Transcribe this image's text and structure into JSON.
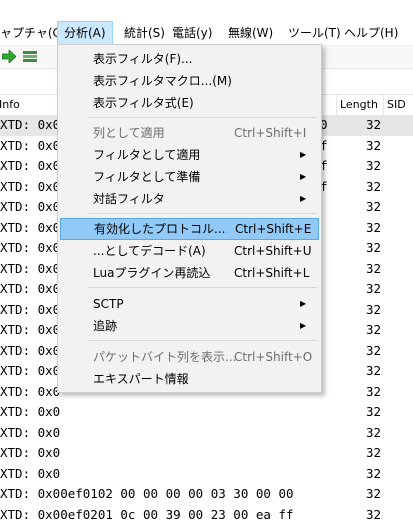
{
  "menubar": {
    "items": [
      {
        "label": "ャプチャ(C)"
      },
      {
        "label": "分析(A)"
      },
      {
        "label": "統計(S)"
      },
      {
        "label": "電話(y)"
      },
      {
        "label": "無線(W)"
      },
      {
        "label": "ツール(T)"
      },
      {
        "label": "ヘルプ(H)"
      }
    ]
  },
  "toolbar": {
    "icons": [
      "forward-arrow-icon",
      "filter-config-icon"
    ]
  },
  "packet_list": {
    "columns": {
      "info": "Info",
      "length": "Length",
      "sid": "SID"
    },
    "rows": [
      {
        "info": "XTD: 0x0",
        "tail": "0",
        "length": "32"
      },
      {
        "info": "XTD: 0x0",
        "tail": "f",
        "length": "32"
      },
      {
        "info": "XTD: 0x0",
        "tail": "f",
        "length": "32"
      },
      {
        "info": "XTD: 0x0",
        "tail": "f",
        "length": "32"
      },
      {
        "info": "XTD: 0x0",
        "tail": "",
        "length": "32"
      },
      {
        "info": "XTD: 0x0",
        "tail": "",
        "length": "32"
      },
      {
        "info": "XTD: 0x0",
        "tail": "",
        "length": "32"
      },
      {
        "info": "XTD: 0x0",
        "tail": "",
        "length": "32"
      },
      {
        "info": "XTD: 0x0",
        "tail": "",
        "length": "32"
      },
      {
        "info": "XTD: 0x0",
        "tail": "",
        "length": "32"
      },
      {
        "info": "XTD: 0x0",
        "tail": "",
        "length": "32"
      },
      {
        "info": "XTD: 0x0",
        "tail": "",
        "length": "32"
      },
      {
        "info": "XTD: 0x0",
        "tail": "",
        "length": "32"
      },
      {
        "info": "XTD: 0x0",
        "tail": "",
        "length": "32"
      },
      {
        "info": "XTD: 0x0",
        "tail": "",
        "length": "32"
      },
      {
        "info": "XTD: 0x0",
        "tail": "",
        "length": "32"
      },
      {
        "info": "XTD: 0x0",
        "tail": "",
        "length": "32"
      },
      {
        "info": "XTD: 0x0",
        "tail": "",
        "length": "32"
      },
      {
        "info": "XTD: 0x00ef0102   00 00 00 00 03 30 00 00",
        "tail": "",
        "length": "32"
      },
      {
        "info": "XTD: 0x00ef0201   0c 00 39 00 23 00 ea ff",
        "tail": "",
        "length": "32"
      }
    ]
  },
  "analyze_menu": {
    "items": [
      {
        "label": "表示フィルタ(F)...",
        "shortcut": "",
        "submenu": false,
        "disabled": false
      },
      {
        "label": "表示フィルタマクロ...(M)",
        "shortcut": "",
        "submenu": false,
        "disabled": false
      },
      {
        "label": "表示フィルタ式(E)",
        "shortcut": "",
        "submenu": false,
        "disabled": false
      },
      {
        "label": "列として適用",
        "shortcut": "Ctrl+Shift+I",
        "submenu": false,
        "disabled": true
      },
      {
        "label": "フィルタとして適用",
        "shortcut": "",
        "submenu": true,
        "disabled": false
      },
      {
        "label": "フィルタとして準備",
        "shortcut": "",
        "submenu": true,
        "disabled": false
      },
      {
        "label": "対話フィルタ",
        "shortcut": "",
        "submenu": true,
        "disabled": false
      },
      {
        "label": "有効化したプロトコル...",
        "shortcut": "Ctrl+Shift+E",
        "submenu": false,
        "disabled": false,
        "highlighted": true
      },
      {
        "label": "...としてデコード(A)",
        "shortcut": "Ctrl+Shift+U",
        "submenu": false,
        "disabled": false
      },
      {
        "label": "Luaプラグイン再読込",
        "shortcut": "Ctrl+Shift+L",
        "submenu": false,
        "disabled": false
      },
      {
        "label": "SCTP",
        "shortcut": "",
        "submenu": true,
        "disabled": false
      },
      {
        "label": "追跡",
        "shortcut": "",
        "submenu": true,
        "disabled": false
      },
      {
        "label": "パケットバイト列を表示...",
        "shortcut": "Ctrl+Shift+O",
        "submenu": false,
        "disabled": true
      },
      {
        "label": "エキスパート情報",
        "shortcut": "",
        "submenu": false,
        "disabled": false
      }
    ],
    "submenu_arrow": "▶"
  },
  "colors": {
    "highlight": "#91c9f7",
    "menu_bg": "#f2f2f2",
    "selected_row": "#e6e6e6"
  }
}
